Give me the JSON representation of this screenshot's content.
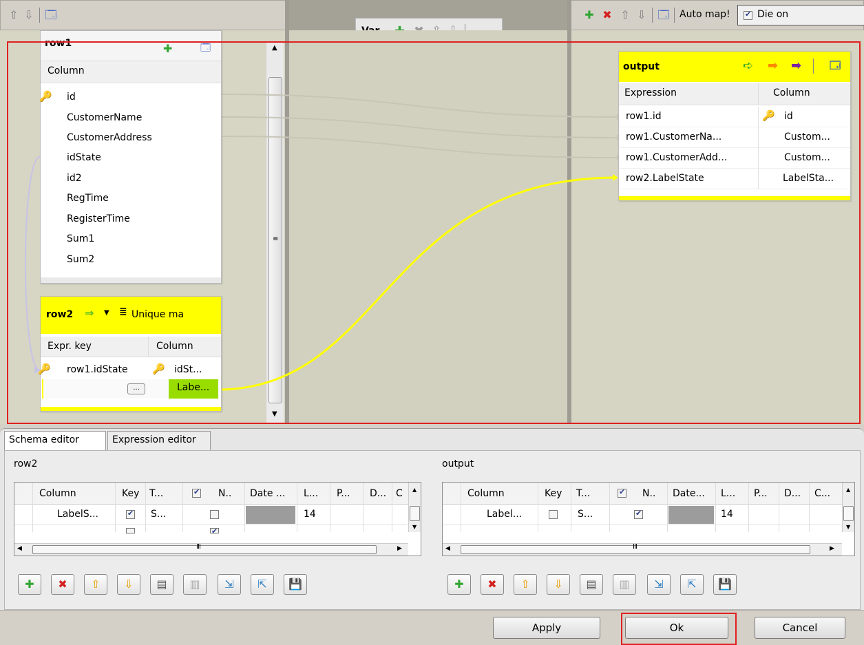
{
  "toolbar_left": {
    "icons": [
      "up-arrow-icon",
      "down-arrow-icon",
      "window-icon"
    ]
  },
  "var_panel": {
    "title": "Var"
  },
  "toolbar_right": {
    "auto_map": "Auto map!",
    "die_on": "Die on",
    "die_on_checked": true
  },
  "row1": {
    "title": "row1",
    "header": "Column",
    "columns": [
      "id",
      "CustomerName",
      "CustomerAddress",
      "idState",
      "id2",
      "RegTime",
      "RegisterTime",
      "Sum1",
      "Sum2"
    ]
  },
  "row2": {
    "title": "row2",
    "match_mode": "Unique ma",
    "header_expr": "Expr. key",
    "header_col": "Column",
    "rows": [
      {
        "expr": "row1.idState",
        "col": "idSt..."
      },
      {
        "expr": "",
        "col": "Labe..."
      }
    ],
    "dots": "..."
  },
  "output": {
    "title": "output",
    "header_expr": "Expression",
    "header_col": "Column",
    "rows": [
      {
        "expr": "row1.id",
        "col": "id"
      },
      {
        "expr": "row1.CustomerNa...",
        "col": "Custom..."
      },
      {
        "expr": "row1.CustomerAdd...",
        "col": "Custom..."
      },
      {
        "expr": "row2.LabelState",
        "col": "LabelSta..."
      }
    ]
  },
  "tabs": [
    "Schema editor",
    "Expression editor"
  ],
  "schema_left": {
    "title": "row2",
    "headers": [
      "Column",
      "Key",
      "T...",
      "N..",
      "Date ...",
      "L...",
      "P...",
      "D...",
      "C"
    ],
    "row": {
      "column": "LabelS...",
      "type": "S...",
      "length": "14"
    }
  },
  "schema_right": {
    "title": "output",
    "headers": [
      "Column",
      "Key",
      "T...",
      "N..",
      "Date...",
      "L...",
      "P...",
      "D...",
      "C..."
    ],
    "row": {
      "column": "Label...",
      "type": "S...",
      "length": "14"
    }
  },
  "buttons": {
    "apply": "Apply",
    "ok": "Ok",
    "cancel": "Cancel"
  },
  "colors": {
    "header_yellow": "#ffff00",
    "link_yellow": "#ffff00",
    "selection_red": "#e02020",
    "label_green": "#99dd00"
  }
}
